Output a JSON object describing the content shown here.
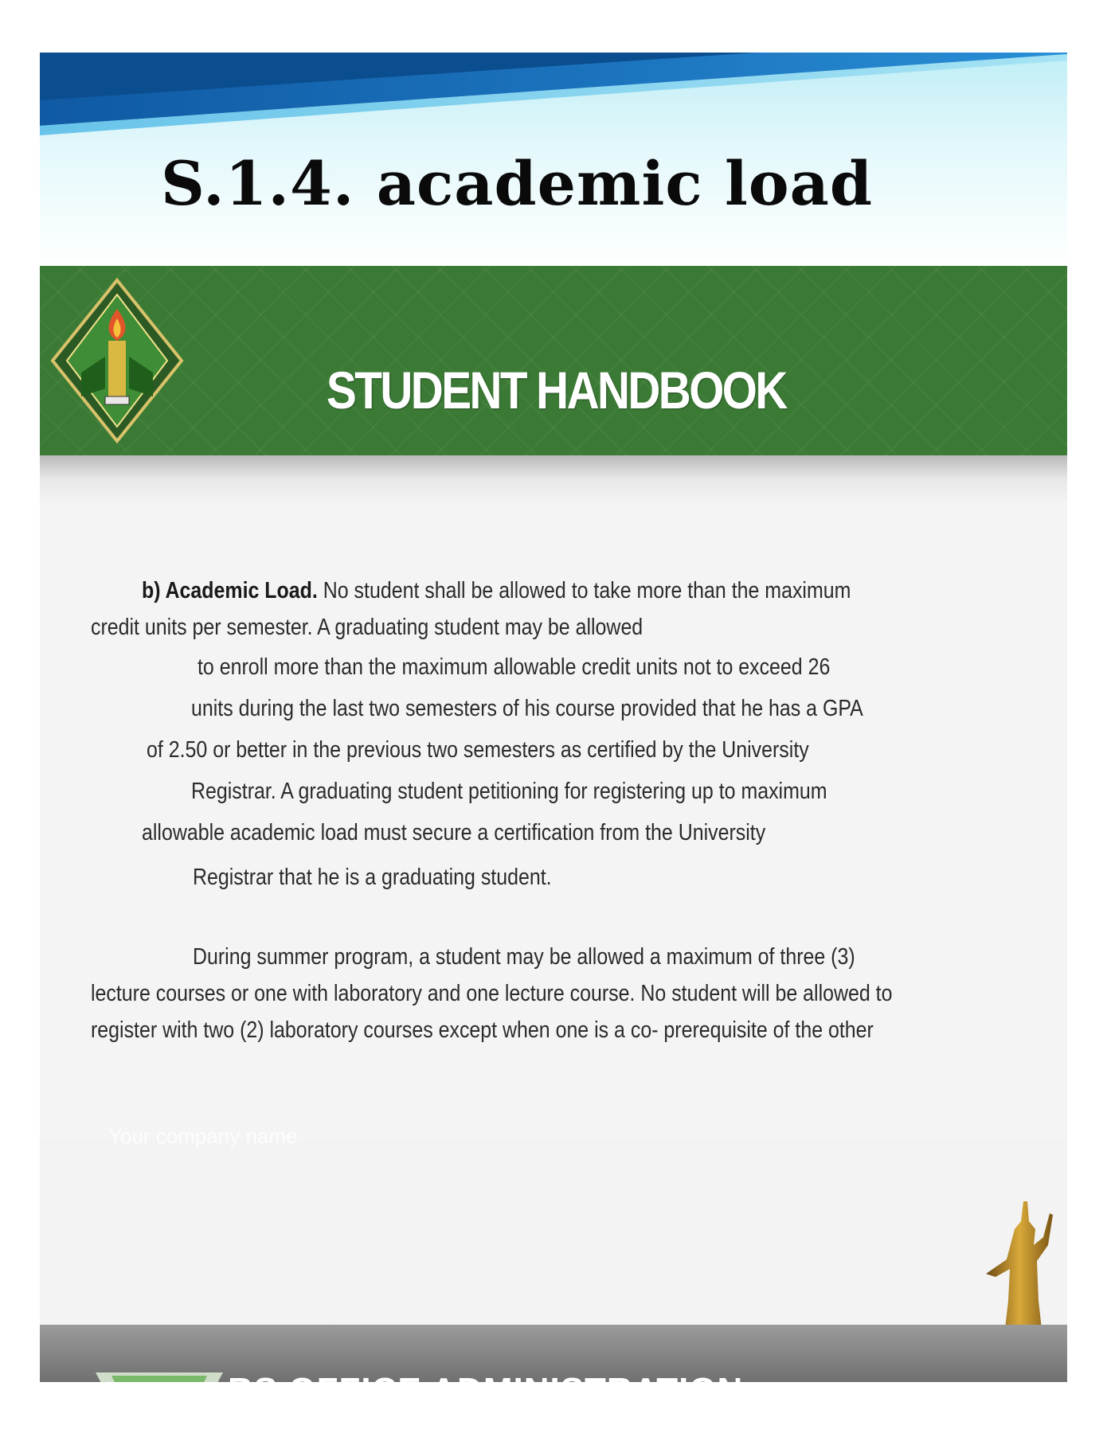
{
  "slide": {
    "title": "S.1.4. academic load"
  },
  "handbook": {
    "header_title": "STUDENT HANDBOOK",
    "paragraph1": {
      "label_prefix": "b)  ",
      "label": "Academic Load.",
      "lines": [
        "  No student shall be allowed to take more than the       maximum",
        "credit units per semester. A graduating student may be allowed",
        "to enroll more than the maximum allowable credit units not to exceed 26",
        "units during the last two semesters of his course provided that he has a GPA",
        "of 2.50 or better in the previous two semesters as certified by the University",
        "Registrar. A graduating student petitioning for registering up to maximum",
        "allowable academic load must secure a certification from the University",
        "Registrar that he is a graduating student."
      ]
    },
    "paragraph2": {
      "lines": [
        "During summer program, a student may be allowed a maximum of three       (3)",
        "lecture courses or one with laboratory and one lecture course. No student will be  allowed       to",
        "register with two (2) laboratory courses except when one is a co- prerequisite of the other"
      ]
    },
    "company_placeholder": "Your company name",
    "footer_title": "BS OFFICE ADMINISTRATION"
  },
  "colors": {
    "banner_blue": "#1565a8",
    "handbook_green": "#3b7a35",
    "footer_green": "#1f7a2e"
  }
}
